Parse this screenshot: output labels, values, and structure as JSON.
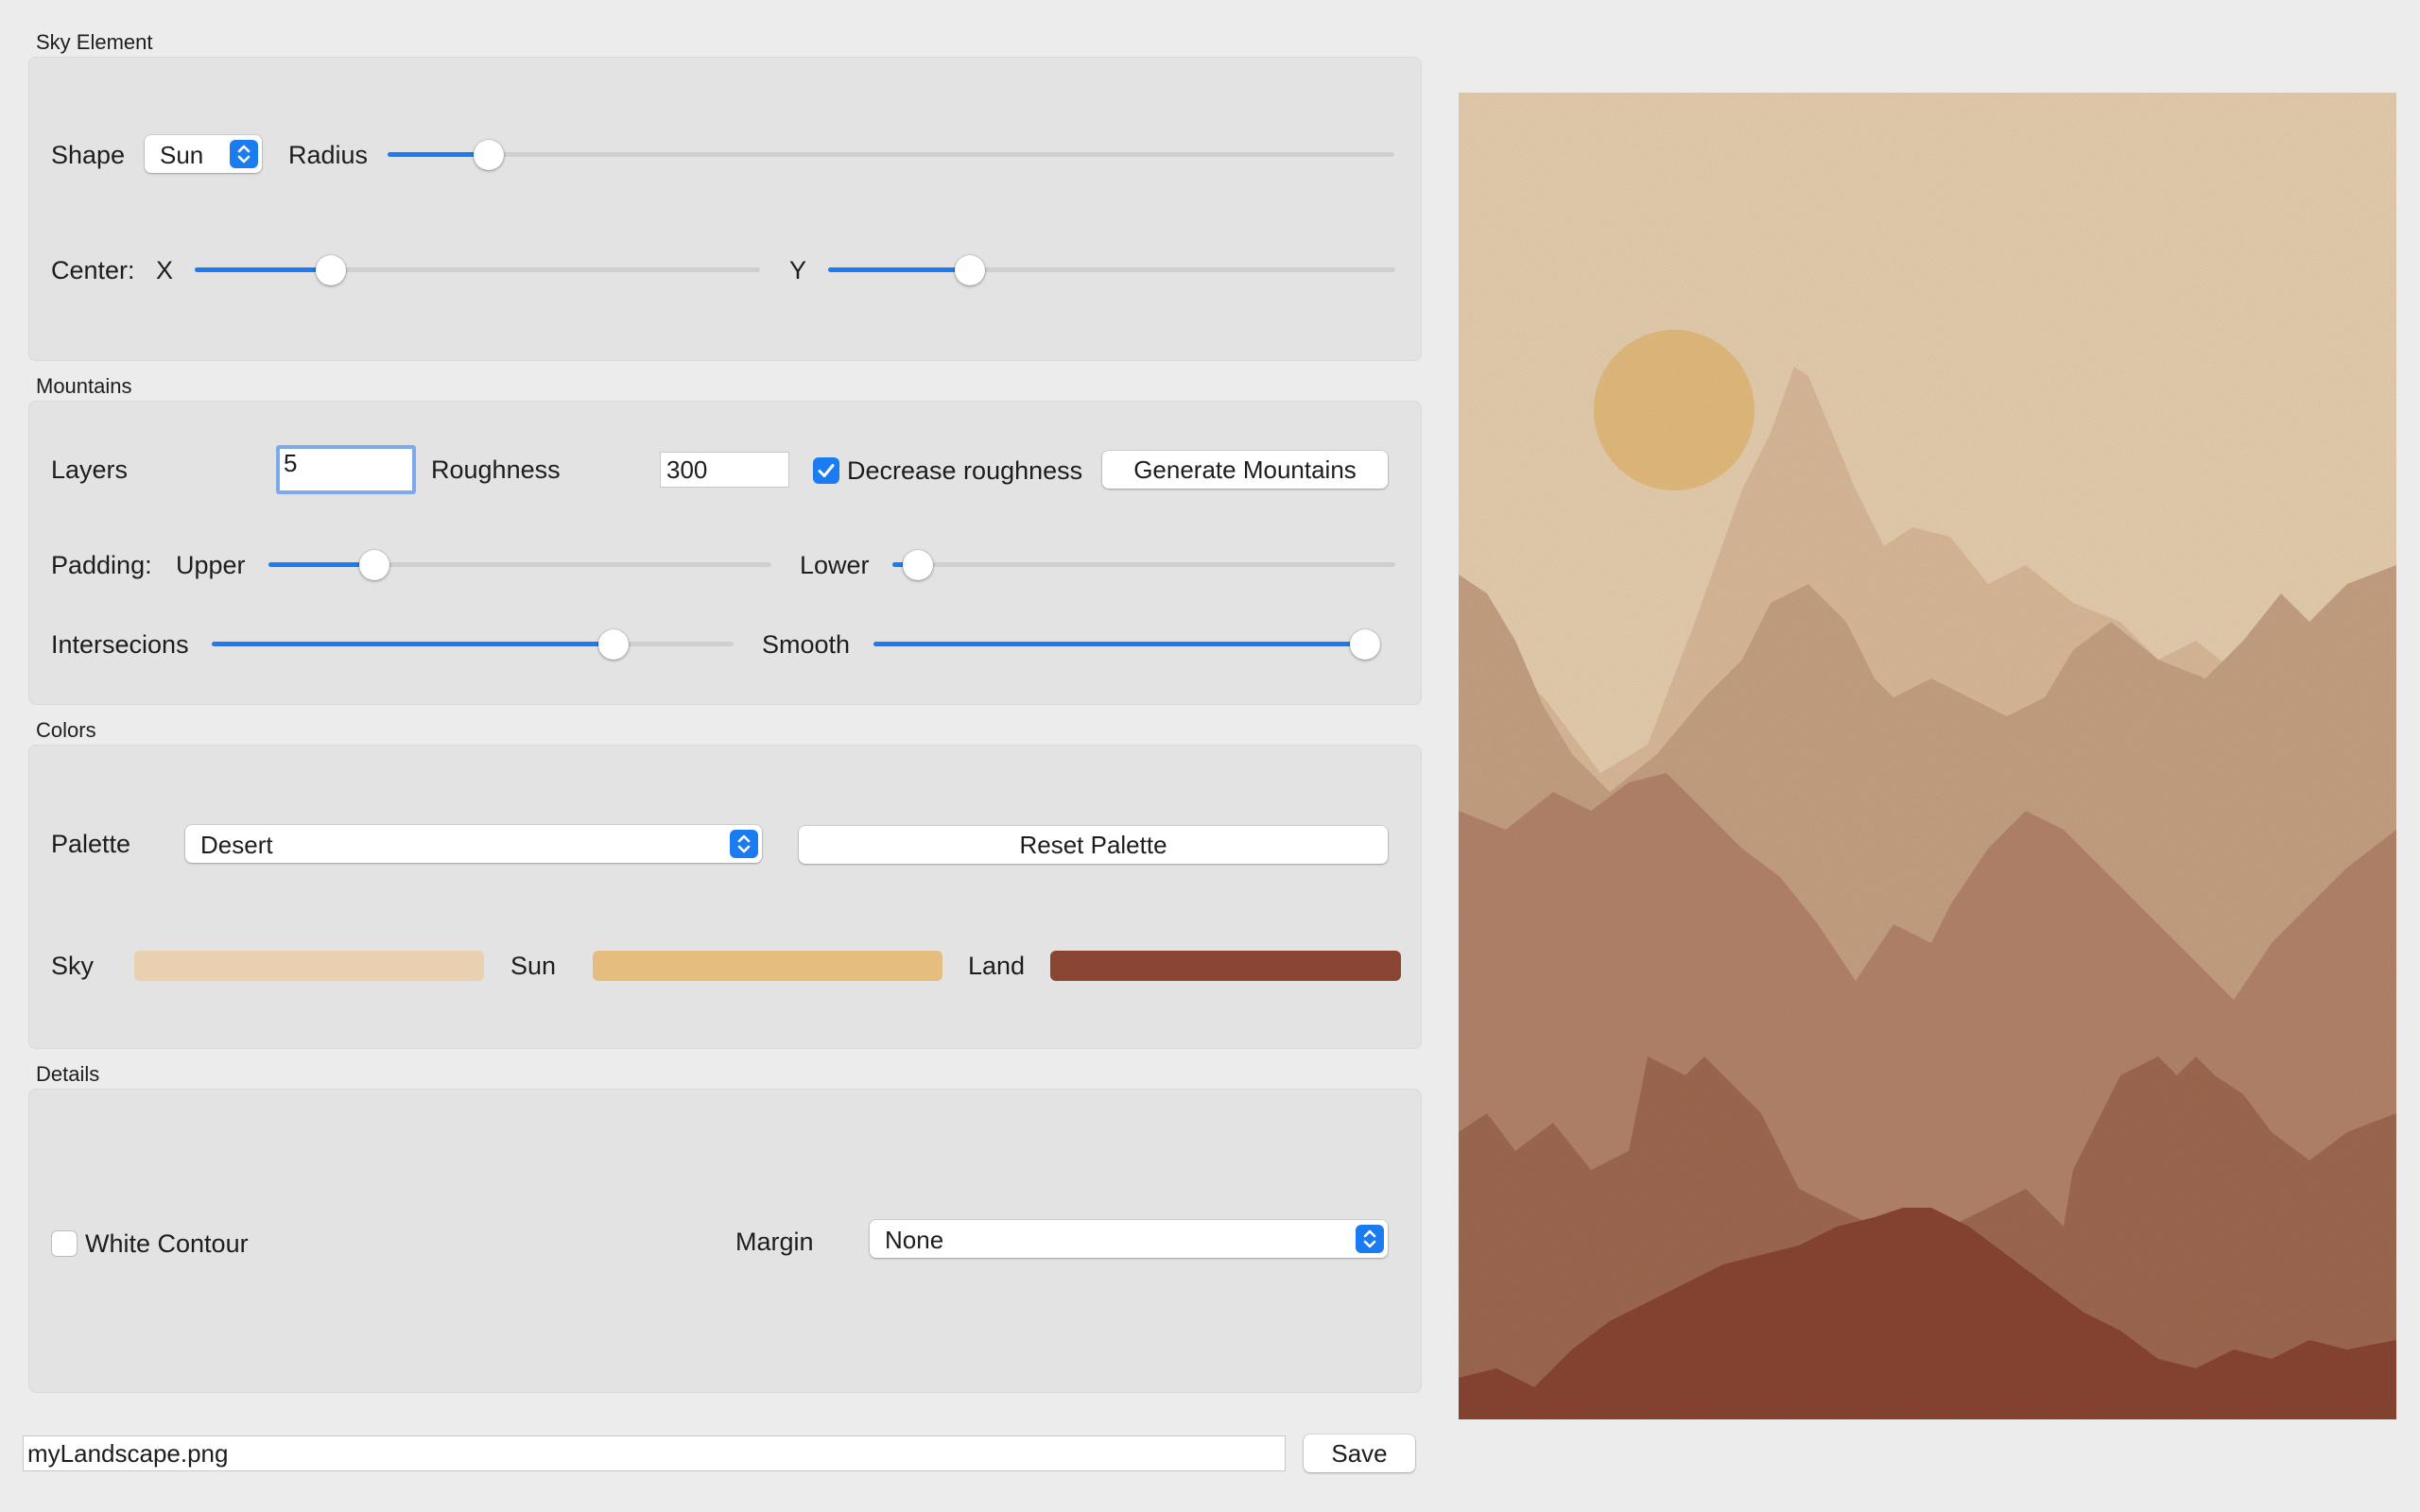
{
  "sky_element": {
    "title": "Sky Element",
    "shape_label": "Shape",
    "shape_value": "Sun",
    "radius_label": "Radius",
    "radius_value": 0.1,
    "center_label": "Center:",
    "x_label": "X",
    "x_value": 0.24,
    "y_label": "Y",
    "y_value": 0.25
  },
  "mountains": {
    "title": "Mountains",
    "layers_label": "Layers",
    "layers_value": "5",
    "roughness_label": "Roughness",
    "roughness_value": "300",
    "decrease_label": "Decrease roughness",
    "decrease_checked": true,
    "generate_label": "Generate Mountains",
    "padding_label": "Padding:",
    "upper_label": "Upper",
    "upper_value": 0.21,
    "lower_label": "Lower",
    "lower_value": 0.05,
    "intersections_label": "Intersecions",
    "intersections_value": 0.77,
    "smooth_label": "Smooth",
    "smooth_value": 1.0
  },
  "colors": {
    "title": "Colors",
    "palette_label": "Palette",
    "palette_value": "Desert",
    "reset_label": "Reset Palette",
    "sky_label": "Sky",
    "sky_color": "#e8d0b0",
    "sun_label": "Sun",
    "sun_color": "#e5bd7e",
    "land_label": "Land",
    "land_color": "#8a4532"
  },
  "details": {
    "title": "Details",
    "contour_label": "White Contour",
    "contour_checked": false,
    "margin_label": "Margin",
    "margin_value": "None"
  },
  "footer": {
    "filename": "myLandscape.png",
    "save_label": "Save"
  },
  "accent_color": "#1a7cf0"
}
